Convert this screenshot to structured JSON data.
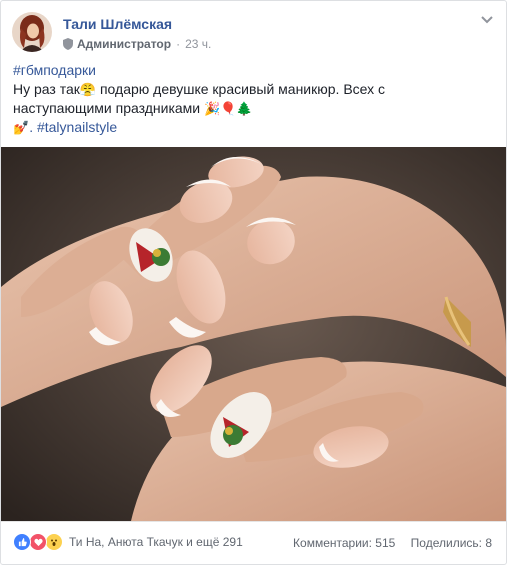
{
  "post": {
    "author": "Тали Шлёмская",
    "role": "Администратор",
    "separator": "·",
    "time": "23 ч.",
    "hashtag_line": "#гбмподарки",
    "text_line1_a": "Ну раз так",
    "text_line1_b": " подарю девушке красивый маникюр. Всех с",
    "text_line2": "наступающими праздниками ",
    "text_line3_hashtag": ". #talynailstyle",
    "emoji_line1": "😤",
    "emoji_line2": "🎉🎈🌲",
    "emoji_line3": "💅"
  },
  "footer": {
    "reactions_names": "Ти На, Анюта Ткачук и ещё 291",
    "comments": "Комментарии: 515",
    "shares": "Поделились: 8"
  },
  "icons": {
    "role": "shield-icon",
    "menu": "chevron-down-icon",
    "reactions": [
      "like-icon",
      "love-icon",
      "wow-icon"
    ]
  },
  "colors": {
    "link": "#365899",
    "muted": "#90949c",
    "like": "#4080ff",
    "love": "#f25268",
    "wow": "#fcd150"
  }
}
